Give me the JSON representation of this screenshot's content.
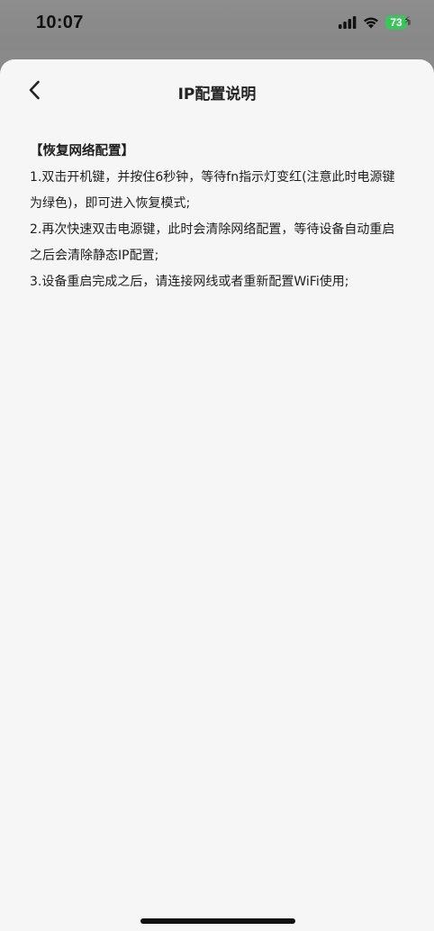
{
  "status_bar": {
    "time": "10:07",
    "battery_level": "73",
    "battery_charging": true,
    "icons": [
      "cellular-signal-icon",
      "wifi-icon",
      "battery-icon"
    ]
  },
  "nav": {
    "back_icon": "chevron-left-icon",
    "title": "IP配置说明"
  },
  "content": {
    "heading": "【恢复网络配置】",
    "steps": [
      "1.双击开机键，并按住6秒钟，等待fn指示灯变红(注意此时电源键为绿色)，即可进入恢复模式;",
      "2.再次快速双击电源键，此时会清除网络配置，等待设备自动重启之后会清除静态IP配置;",
      "3.设备重启完成之后，请连接网线或者重新配置WiFi使用;"
    ]
  },
  "colors": {
    "sheet_background": "#f6f6f6",
    "backdrop": "#8a8a8a",
    "battery": "#3cc35b",
    "text": "#1e1e1e"
  }
}
